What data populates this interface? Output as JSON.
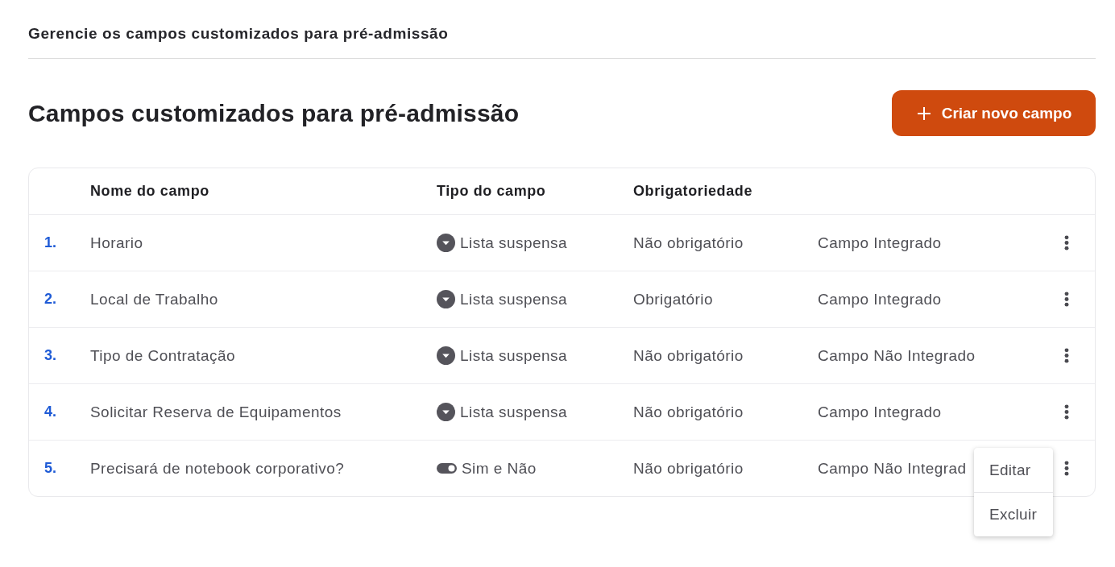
{
  "page_heading": "Gerencie os campos customizados para pré-admissão",
  "header": {
    "title": "Campos customizados para pré-admissão",
    "create_button": {
      "label": "Criar novo campo"
    }
  },
  "table": {
    "columns": [
      "Nome do campo",
      "Tipo do campo",
      "Obrigatoriedade"
    ],
    "rows": [
      {
        "number": "1.",
        "name": "Horario",
        "type": {
          "kind": "dropdown",
          "label": "Lista suspensa"
        },
        "required": "Não obrigatório",
        "integration": "Campo Integrado"
      },
      {
        "number": "2.",
        "name": "Local de Trabalho",
        "type": {
          "kind": "dropdown",
          "label": "Lista suspensa"
        },
        "required": "Obrigatório",
        "integration": "Campo Integrado"
      },
      {
        "number": "3.",
        "name": "Tipo de Contratação",
        "type": {
          "kind": "dropdown",
          "label": "Lista suspensa"
        },
        "required": "Não obrigatório",
        "integration": "Campo Não Integrado"
      },
      {
        "number": "4.",
        "name": "Solicitar Reserva de Equipamentos",
        "type": {
          "kind": "dropdown",
          "label": "Lista suspensa"
        },
        "required": "Não obrigatório",
        "integration": "Campo Integrado"
      },
      {
        "number": "5.",
        "name": "Precisará de notebook corporativo?",
        "type": {
          "kind": "toggle",
          "label": "Sim e Não"
        },
        "required": "Não obrigatório",
        "integration": "Campo Não Integrad",
        "menu": [
          "Editar",
          "Excluir"
        ]
      }
    ]
  }
}
